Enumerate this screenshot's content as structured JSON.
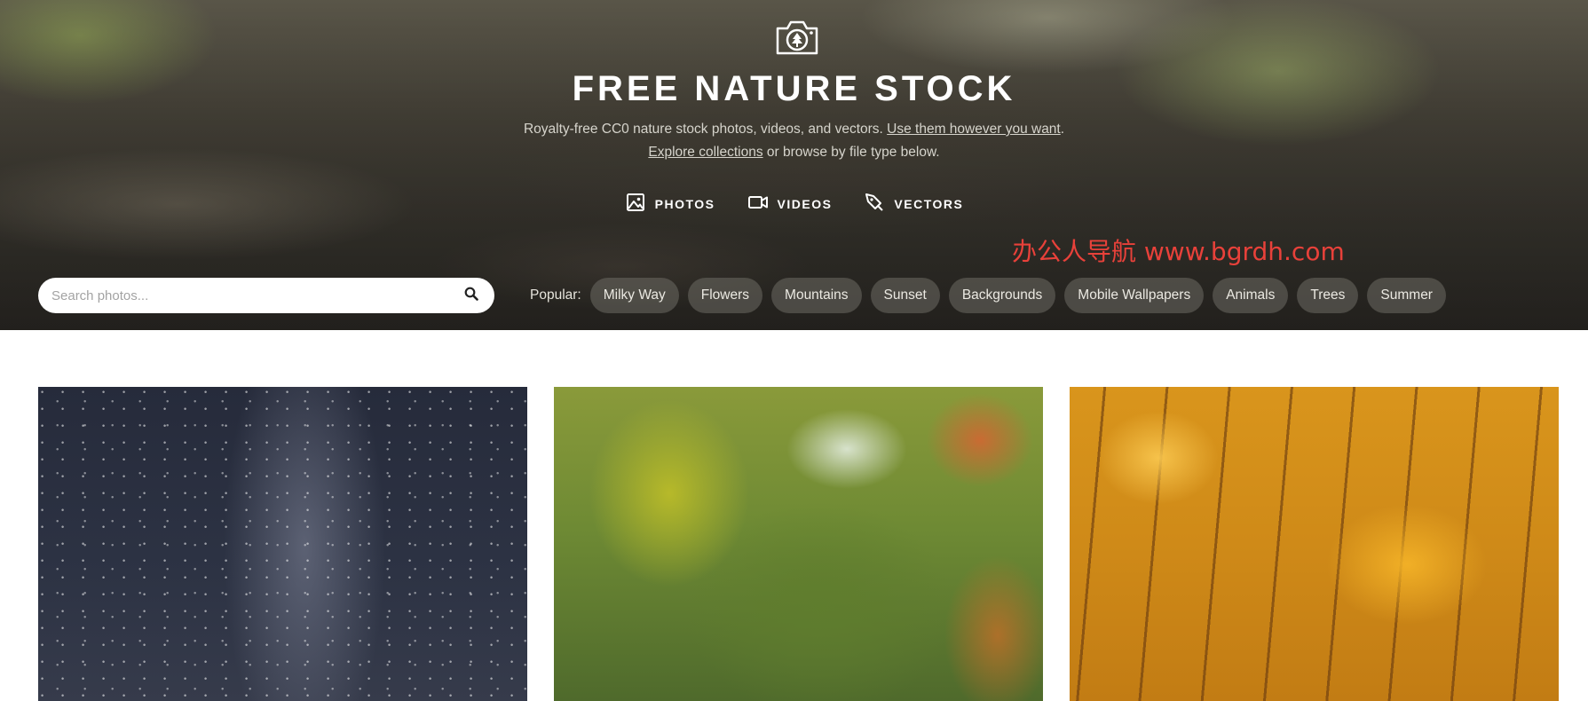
{
  "header": {
    "logo_icon": "camera-tree-icon",
    "title": "FREE NATURE STOCK",
    "tagline": {
      "line1_text": "Royalty-free CC0 nature stock photos, videos, and vectors.",
      "line1_link": "Use them however you want",
      "line1_end": ".",
      "line2_link": "Explore collections",
      "line2_text": "or browse by file type below."
    },
    "type_nav": [
      {
        "label": "PHOTOS",
        "icon": "image-icon"
      },
      {
        "label": "VIDEOS",
        "icon": "video-camera-icon"
      },
      {
        "label": "VECTORS",
        "icon": "vector-pen-icon"
      }
    ],
    "watermark": "办公人导航 www.bgrdh.com"
  },
  "search": {
    "placeholder": "Search photos...",
    "icon": "search-icon"
  },
  "popular": {
    "label": "Popular:",
    "tags": [
      "Milky Way",
      "Flowers",
      "Mountains",
      "Sunset",
      "Backgrounds",
      "Mobile Wallpapers",
      "Animals",
      "Trees",
      "Summer"
    ]
  },
  "gallery": {
    "photos": [
      "milky-way-night-sky",
      "autumn-forest-road",
      "golden-autumn-leaves"
    ]
  },
  "colors": {
    "watermark": "#e8413a",
    "tag_background": "rgba(110,108,100,0.55)",
    "title": "#ffffff"
  }
}
